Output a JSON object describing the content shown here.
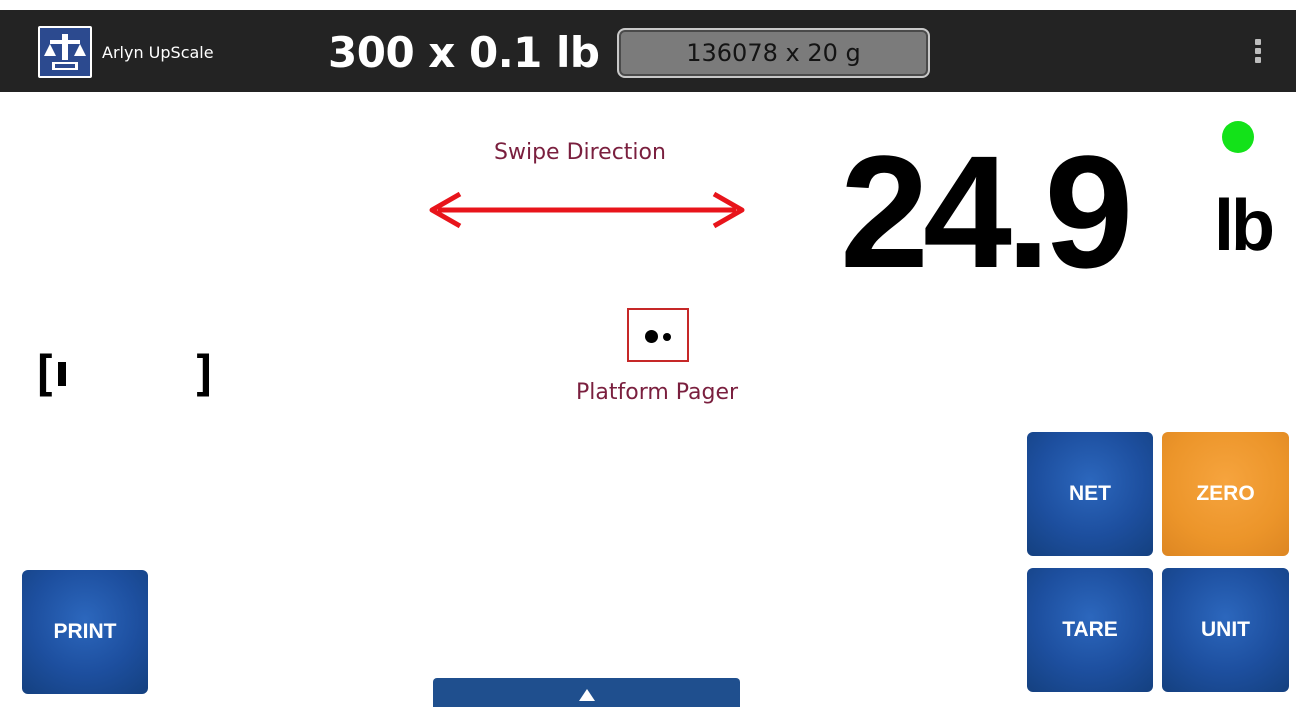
{
  "appbar": {
    "app_name": "Arlyn UpScale",
    "capacity_lb": "300 x 0.1 lb",
    "capacity_g": "136078 x 20 g",
    "menu_icon": "overflow-menu-icon"
  },
  "annotations": {
    "swipe_label": "Swipe Direction",
    "pager_label": "Platform Pager"
  },
  "display": {
    "weight": "24.9",
    "unit": "lb",
    "status_color": "#13e219"
  },
  "keys": {
    "print": "PRINT",
    "net": "NET",
    "zero": "ZERO",
    "tare": "TARE",
    "unit": "UNIT"
  },
  "colors": {
    "key_blue": "#2053a3",
    "key_orange": "#ef9a2e",
    "appbar": "#232323",
    "annotation_text": "#7a1f3e",
    "annotation_red": "#c62828"
  }
}
